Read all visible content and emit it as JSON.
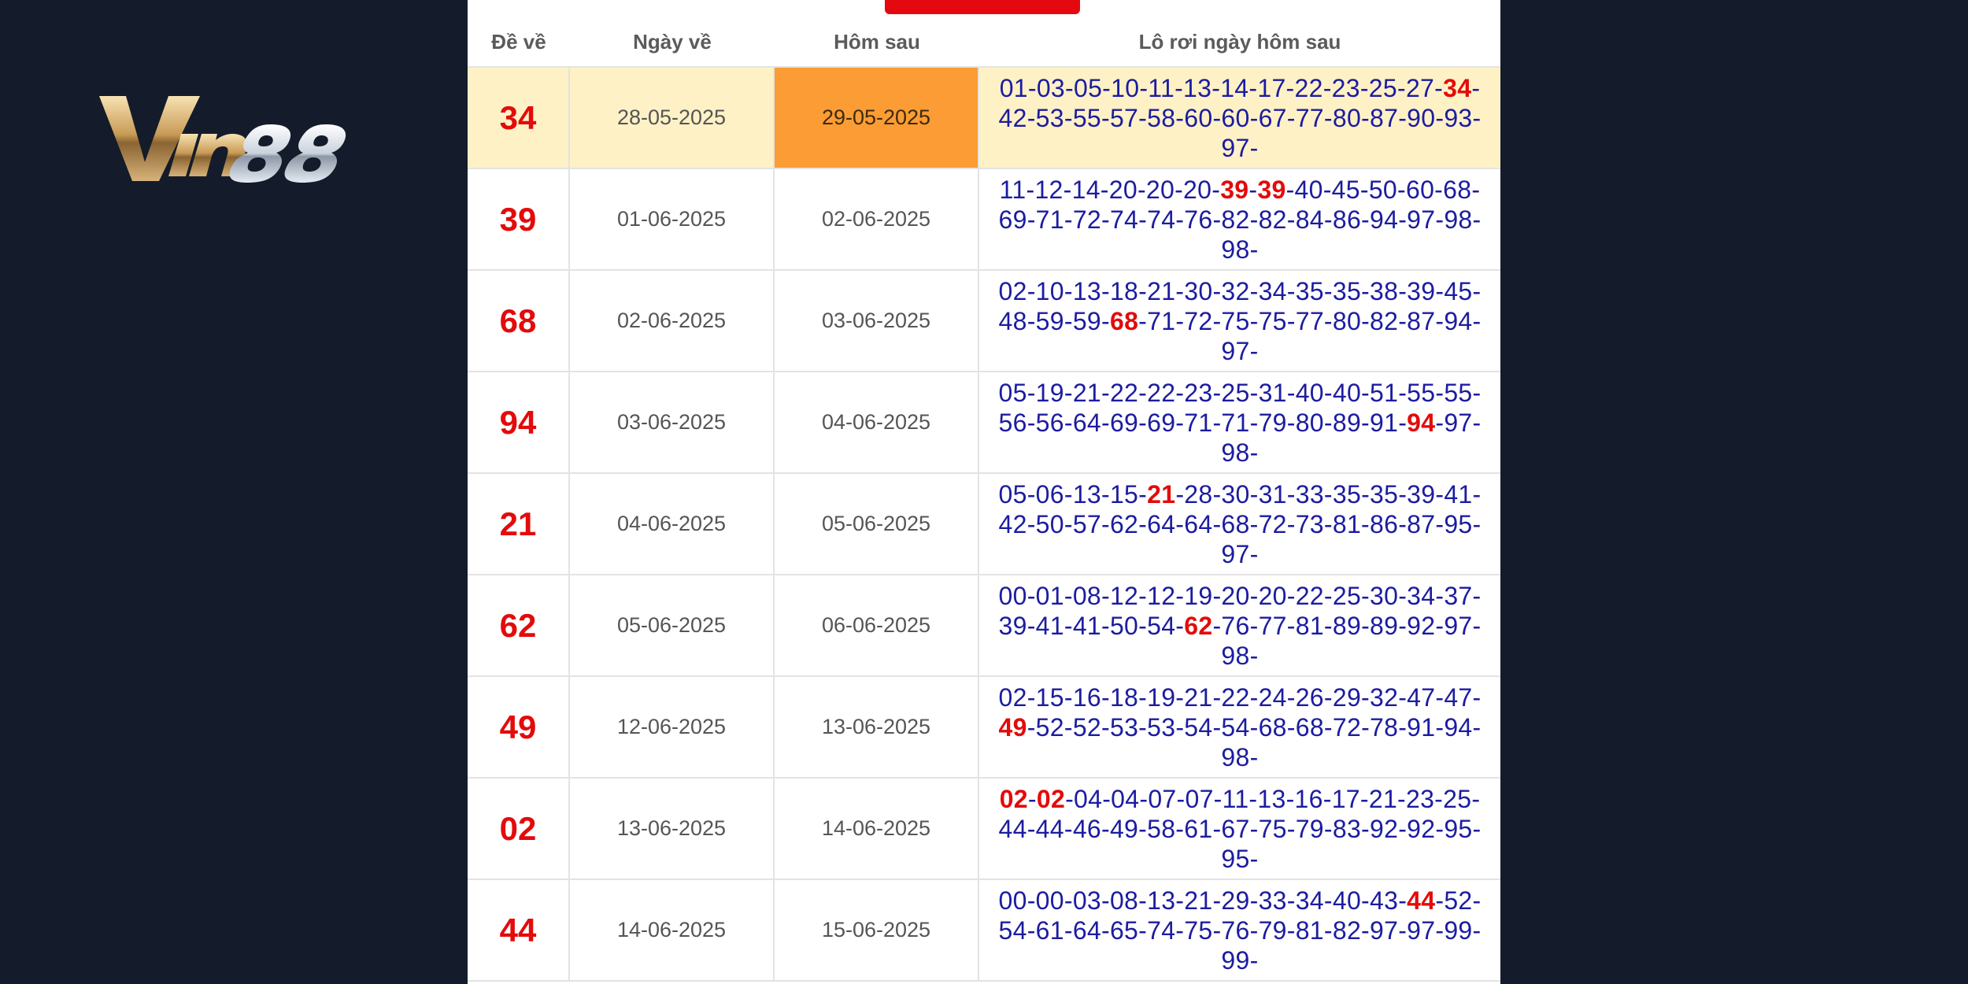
{
  "brand": {
    "logo_text": "Vin88"
  },
  "table": {
    "headers": {
      "de_ve": "Đề về",
      "ngay_ve": "Ngày về",
      "hom_sau": "Hôm sau",
      "lo_roi": "Lô rơi ngày hôm sau"
    },
    "rows": [
      {
        "de": "34",
        "ngay_ve": "28-05-2025",
        "hom_sau": "29-05-2025",
        "highlight": true,
        "lo_lines": [
          [
            [
              "01-03-05-10-11-13-14-17-22-23-25-27-",
              false
            ],
            [
              "34",
              true
            ],
            [
              "-",
              false
            ]
          ],
          [
            [
              "42-53-55-57-58-60-60-67-77-80-87-90-93-",
              false
            ]
          ],
          [
            [
              "97-",
              false
            ]
          ]
        ]
      },
      {
        "de": "39",
        "ngay_ve": "01-06-2025",
        "hom_sau": "02-06-2025",
        "highlight": false,
        "lo_lines": [
          [
            [
              "11-12-14-20-20-20-",
              false
            ],
            [
              "39",
              true
            ],
            [
              "-",
              false
            ],
            [
              "39",
              true
            ],
            [
              "-40-45-50-60-68-",
              false
            ]
          ],
          [
            [
              "69-71-72-74-74-76-82-82-84-86-94-97-98-",
              false
            ]
          ],
          [
            [
              "98-",
              false
            ]
          ]
        ]
      },
      {
        "de": "68",
        "ngay_ve": "02-06-2025",
        "hom_sau": "03-06-2025",
        "highlight": false,
        "lo_lines": [
          [
            [
              "02-10-13-18-21-30-32-34-35-35-38-39-45-",
              false
            ]
          ],
          [
            [
              "48-59-59-",
              false
            ],
            [
              "68",
              true
            ],
            [
              "-71-72-75-75-77-80-82-87-94-",
              false
            ]
          ],
          [
            [
              "97-",
              false
            ]
          ]
        ]
      },
      {
        "de": "94",
        "ngay_ve": "03-06-2025",
        "hom_sau": "04-06-2025",
        "highlight": false,
        "lo_lines": [
          [
            [
              "05-19-21-22-22-23-25-31-40-40-51-55-55-",
              false
            ]
          ],
          [
            [
              "56-56-64-69-69-71-71-79-80-89-91-",
              false
            ],
            [
              "94",
              true
            ],
            [
              "-97-",
              false
            ]
          ],
          [
            [
              "98-",
              false
            ]
          ]
        ]
      },
      {
        "de": "21",
        "ngay_ve": "04-06-2025",
        "hom_sau": "05-06-2025",
        "highlight": false,
        "lo_lines": [
          [
            [
              "05-06-13-15-",
              false
            ],
            [
              "21",
              true
            ],
            [
              "-28-30-31-33-35-35-39-41-",
              false
            ]
          ],
          [
            [
              "42-50-57-62-64-64-68-72-73-81-86-87-95-",
              false
            ]
          ],
          [
            [
              "97-",
              false
            ]
          ]
        ]
      },
      {
        "de": "62",
        "ngay_ve": "05-06-2025",
        "hom_sau": "06-06-2025",
        "highlight": false,
        "lo_lines": [
          [
            [
              "00-01-08-12-12-19-20-20-22-25-30-34-37-",
              false
            ]
          ],
          [
            [
              "39-41-41-50-54-",
              false
            ],
            [
              "62",
              true
            ],
            [
              "-76-77-81-89-89-92-97-",
              false
            ]
          ],
          [
            [
              "98-",
              false
            ]
          ]
        ]
      },
      {
        "de": "49",
        "ngay_ve": "12-06-2025",
        "hom_sau": "13-06-2025",
        "highlight": false,
        "lo_lines": [
          [
            [
              "02-15-16-18-19-21-22-24-26-29-32-47-47-",
              false
            ]
          ],
          [
            [
              "49",
              true
            ],
            [
              "-52-52-53-53-54-54-68-68-72-78-91-94-",
              false
            ]
          ],
          [
            [
              "98-",
              false
            ]
          ]
        ]
      },
      {
        "de": "02",
        "ngay_ve": "13-06-2025",
        "hom_sau": "14-06-2025",
        "highlight": false,
        "lo_lines": [
          [
            [
              "02",
              true
            ],
            [
              "-",
              false
            ],
            [
              "02",
              true
            ],
            [
              "-04-04-07-07-11-13-16-17-21-23-25-",
              false
            ]
          ],
          [
            [
              "44-44-46-49-58-61-67-75-79-83-92-92-95-",
              false
            ]
          ],
          [
            [
              "95-",
              false
            ]
          ]
        ]
      },
      {
        "de": "44",
        "ngay_ve": "14-06-2025",
        "hom_sau": "15-06-2025",
        "highlight": false,
        "lo_lines": [
          [
            [
              "00-00-03-08-13-21-29-33-34-40-43-",
              false
            ],
            [
              "44",
              true
            ],
            [
              "-52-",
              false
            ]
          ],
          [
            [
              "54-61-64-65-74-75-76-79-81-82-97-97-99-",
              false
            ]
          ],
          [
            [
              "99-",
              false
            ]
          ]
        ]
      }
    ]
  },
  "colors": {
    "background": "#141c2b",
    "accent_red": "#e30b0b",
    "highlight_row": "#fff1c6",
    "highlight_cell": "#fb9c34",
    "number_blue": "#1c1ca0"
  }
}
